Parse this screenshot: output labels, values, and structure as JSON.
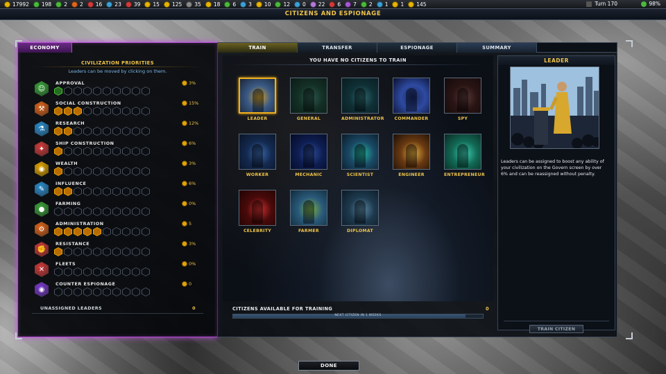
{
  "topbar": {
    "resources": [
      {
        "icon": "credits-icon",
        "color": "#e6b400",
        "value": "17992"
      },
      {
        "icon": "food-icon",
        "color": "#49b93a",
        "value": "198"
      },
      {
        "icon": "approval-icon",
        "color": "#49b93a",
        "value": "2"
      },
      {
        "icon": "manufacturing-icon",
        "color": "#e0651a",
        "value": "2"
      },
      {
        "icon": "research-icon",
        "color": "#d23a3a",
        "value": "16"
      },
      {
        "icon": "science-icon",
        "color": "#3aa0d6",
        "value": "23"
      },
      {
        "icon": "military-icon",
        "color": "#d23a3a",
        "value": "39"
      },
      {
        "icon": "wealth-icon",
        "color": "#e6b400",
        "value": "15"
      },
      {
        "icon": "influence-icon",
        "color": "#e6b400",
        "value": "125"
      },
      {
        "icon": "ideology-icon",
        "color": "#8a8a8a",
        "value": "35"
      },
      {
        "icon": "benevolent-icon",
        "color": "#e6b400",
        "value": "18"
      },
      {
        "icon": "pragmatic-icon",
        "color": "#49b93a",
        "value": "6"
      },
      {
        "icon": "malevolent-icon",
        "color": "#3aa0d6",
        "value": "3"
      },
      {
        "icon": "resource-a-icon",
        "color": "#e6b400",
        "value": "10"
      },
      {
        "icon": "resource-b-icon",
        "color": "#49b93a",
        "value": "12"
      },
      {
        "icon": "resource-c-icon",
        "color": "#3aa0d6",
        "value": "0"
      },
      {
        "icon": "resource-d-icon",
        "color": "#b27ad8",
        "value": "22"
      },
      {
        "icon": "resource-e-icon",
        "color": "#d23a3a",
        "value": "6"
      },
      {
        "icon": "resource-f-icon",
        "color": "#a855d6",
        "value": "7"
      },
      {
        "icon": "resource-g-icon",
        "color": "#49b93a",
        "value": "2"
      },
      {
        "icon": "resource-h-icon",
        "color": "#3aa0d6",
        "value": "1"
      },
      {
        "icon": "resource-i-icon",
        "color": "#e6b400",
        "value": "1"
      },
      {
        "icon": "population-icon",
        "color": "#e6b400",
        "value": "145"
      }
    ],
    "turn": "Turn 170",
    "percent": "98%"
  },
  "window_title": "Citizens and Espionage",
  "left": {
    "tab": "Economy",
    "title": "Civilization Priorities",
    "subtitle": "Leaders can be moved by clicking on them.",
    "priorities": [
      {
        "name": "Approval",
        "icon": "approval-icon",
        "color": "#3aa63a",
        "filled": 1,
        "value": "3%",
        "slot_style": "green"
      },
      {
        "name": "Social Construction",
        "icon": "hammer-icon",
        "color": "#e0651a",
        "filled": 3,
        "value": "15%",
        "slot_style": "gold"
      },
      {
        "name": "Research",
        "icon": "flask-icon",
        "color": "#2a8fd0",
        "filled": 2,
        "value": "12%",
        "slot_style": "gold"
      },
      {
        "name": "Ship Construction",
        "icon": "ship-icon",
        "color": "#d23a3a",
        "filled": 1,
        "value": "6%",
        "slot_style": "gold"
      },
      {
        "name": "Wealth",
        "icon": "coins-icon",
        "color": "#e6a800",
        "filled": 1,
        "value": "3%",
        "slot_style": "gold"
      },
      {
        "name": "Influence",
        "icon": "influence-icon",
        "color": "#2a8fd0",
        "filled": 2,
        "value": "6%",
        "slot_style": "gold"
      },
      {
        "name": "Farming",
        "icon": "apple-icon",
        "color": "#3aa63a",
        "filled": 0,
        "value": "0%",
        "slot_style": "gold"
      },
      {
        "name": "Administration",
        "icon": "gear-icon",
        "color": "#e0651a",
        "filled": 5,
        "value": "5",
        "slot_style": "orange"
      },
      {
        "name": "Resistance",
        "icon": "resistance-icon",
        "color": "#d23a3a",
        "filled": 1,
        "value": "3%",
        "slot_style": "gold"
      },
      {
        "name": "Fleets",
        "icon": "fleet-icon",
        "color": "#d23a3a",
        "filled": 0,
        "value": "0%",
        "slot_style": "gold"
      },
      {
        "name": "Counter Espionage",
        "icon": "eye-icon",
        "color": "#7a3ad0",
        "filled": 0,
        "value": "0",
        "slot_style": "gold"
      }
    ],
    "slot_count": 10,
    "unassigned_label": "Unassigned Leaders",
    "unassigned_value": "0"
  },
  "tabs": [
    "Train",
    "Transfer",
    "Espionage",
    "Summary"
  ],
  "train": {
    "header": "You have no citizens to train",
    "citizens": [
      {
        "label": "Leader",
        "selected": true
      },
      {
        "label": "General",
        "selected": false
      },
      {
        "label": "Administrator",
        "selected": false
      },
      {
        "label": "Commander",
        "selected": false
      },
      {
        "label": "Spy",
        "selected": false
      },
      {
        "label": "Worker",
        "selected": false
      },
      {
        "label": "Mechanic",
        "selected": false
      },
      {
        "label": "Scientist",
        "selected": false
      },
      {
        "label": "Engineer",
        "selected": false
      },
      {
        "label": "Entrepreneur",
        "selected": false
      },
      {
        "label": "Celebrity",
        "selected": false
      },
      {
        "label": "Farmer",
        "selected": false
      },
      {
        "label": "Diplomat",
        "selected": false
      }
    ],
    "available_label": "Citizens Available for Training",
    "available_value": "0",
    "progress_text": "Next Citizen in 1 Weeks",
    "progress_fraction": 0.93
  },
  "leader": {
    "title": "Leader",
    "description": "Leaders can be assigned to boost any ability of your civilization on the Govern screen by over 6% and can be reassigned without penalty.",
    "train_button": "Train Citizen"
  },
  "done_button": "Done"
}
